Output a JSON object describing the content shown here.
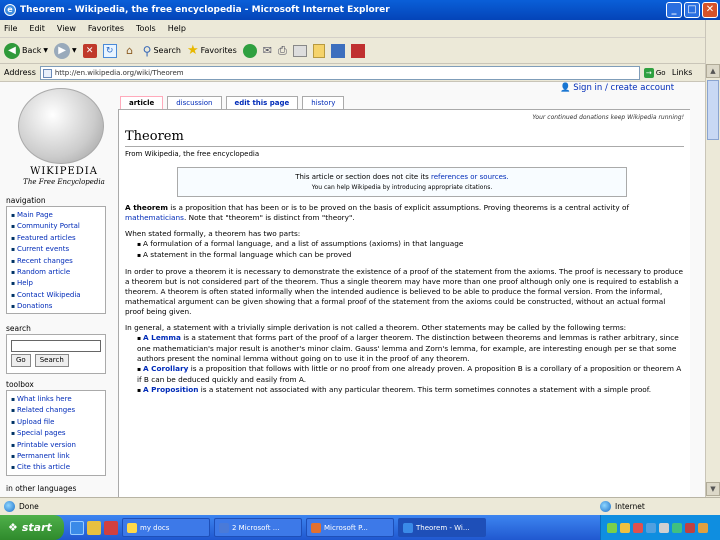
{
  "window": {
    "title": "Theorem - Wikipedia, the free encyclopedia - Microsoft Internet Explorer",
    "min": "_",
    "max": "□",
    "close": "✕"
  },
  "menu": [
    "File",
    "Edit",
    "View",
    "Favorites",
    "Tools",
    "Help"
  ],
  "toolbar": {
    "back": "Back",
    "search": "Search",
    "favorites": "Favorites"
  },
  "address": {
    "label": "Address",
    "url": "http://en.wikipedia.org/wiki/Theorem",
    "go": "Go",
    "links": "Links"
  },
  "wiki": {
    "logo_title": "WIKIPEDIA",
    "logo_subtitle": "The Free Encyclopedia",
    "signin": "Sign in / create account",
    "tabs": [
      "article",
      "discussion",
      "edit this page",
      "history"
    ],
    "donate": "Your continued donations keep Wikipedia running!",
    "title": "Theorem",
    "from": "From Wikipedia, the free encyclopedia",
    "notice_pre": "This article or section does not cite its ",
    "notice_link": "references or sources.",
    "notice_small": "You can help Wikipedia by introducing appropriate citations.",
    "nav_heading": "navigation",
    "nav_items": [
      "Main Page",
      "Community Portal",
      "Featured articles",
      "Current events",
      "Recent changes",
      "Random article",
      "Help",
      "Contact Wikipedia",
      "Donations"
    ],
    "search_heading": "search",
    "search_go": "Go",
    "search_btn": "Search",
    "toolbox_heading": "toolbox",
    "toolbox_items": [
      "What links here",
      "Related changes",
      "Upload file",
      "Special pages",
      "Printable version",
      "Permanent link",
      "Cite this article"
    ],
    "other_heading": "in other languages",
    "p1_bold": "A theorem",
    "p1": " is a proposition that has been or is to be proved on the basis of explicit assumptions. Proving theorems is a central activity of ",
    "p1_link": "mathematicians",
    "p1_end": ". Note that \"theorem\" is distinct from \"theory\".",
    "p2": "When stated formally, a theorem has two parts:",
    "list": [
      "A formulation of a formal language, and a list of assumptions (axioms) in that language",
      "A statement in the formal language which can be proved"
    ],
    "p3": "In order to prove a theorem it is necessary to demonstrate the existence of a proof of the statement from the axioms. The proof is necessary to produce a theorem but is not considered part of the theorem. Thus a single theorem may have more than one proof although only one is required to establish a theorem. A theorem is often stated informally when the intended audience is believed to be able to produce the formal version. From the informal, mathematical argument can be given showing that a formal proof of the statement from the axioms could be constructed, without an actual formal proof being given.",
    "p4": "In general, a statement with a trivially simple derivation is not called a theorem. Other statements may be called by the following terms:",
    "terms": [
      {
        "term": "A Lemma",
        "text": " is a statement that forms part of the proof of a larger theorem. The distinction between theorems and lemmas is rather arbitrary, since one mathematician's major result is another's minor claim. Gauss' lemma and Zorn's lemma, for example, are interesting enough per se that some authors present the nominal lemma without going on to use it in the proof of any theorem."
      },
      {
        "term": "A Corollary",
        "text": " is a proposition that follows with little or no proof from one already proven. A proposition B is a corollary of a proposition or theorem A if B can be deduced quickly and easily from A."
      },
      {
        "term": "A Proposition",
        "text": " is a statement not associated with any particular theorem. This term sometimes connotes a statement with a simple proof."
      }
    ]
  },
  "status": {
    "text": "Done",
    "zone": "Internet"
  },
  "taskbar": {
    "start": "start",
    "tasks": [
      "my docs",
      "2 Microsoft ...",
      "Microsoft P...",
      "Theorem - Wi..."
    ],
    "active_index": 3
  }
}
